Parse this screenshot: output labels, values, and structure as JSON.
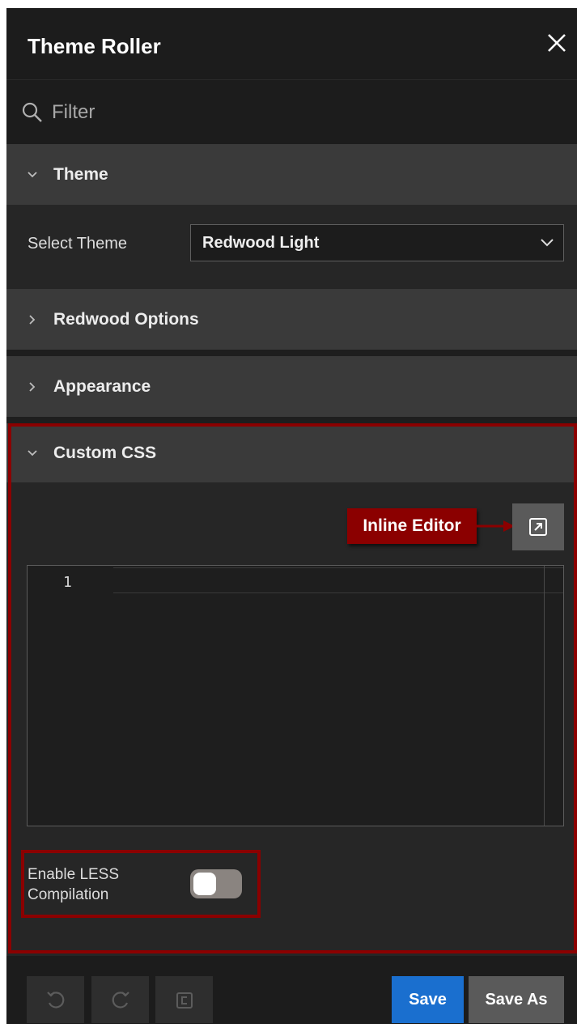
{
  "header": {
    "title": "Theme Roller",
    "close_icon": "close-icon"
  },
  "filter": {
    "placeholder": "Filter",
    "value": ""
  },
  "sections": {
    "theme": {
      "label": "Theme",
      "expanded": true,
      "select_label": "Select Theme",
      "selected_theme": "Redwood Light"
    },
    "redwood_options": {
      "label": "Redwood Options",
      "expanded": false
    },
    "appearance": {
      "label": "Appearance",
      "expanded": false
    },
    "custom_css": {
      "label": "Custom CSS",
      "expanded": true,
      "callout": "Inline Editor",
      "editor": {
        "line_numbers": [
          "1"
        ],
        "content": ""
      },
      "less_label": "Enable LESS Compilation",
      "less_enabled": false
    }
  },
  "footer": {
    "save_label": "Save",
    "save_as_label": "Save As"
  },
  "colors": {
    "accent": "#1a6fcf",
    "highlight": "#8b0000",
    "panel": "#262626"
  }
}
